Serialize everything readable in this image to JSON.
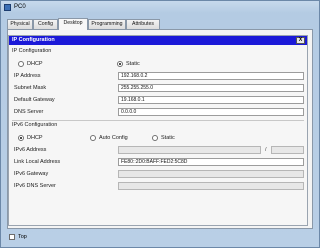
{
  "window": {
    "title": "PC0"
  },
  "tabs": [
    {
      "label": "Physical"
    },
    {
      "label": "Config"
    },
    {
      "label": "Desktop"
    },
    {
      "label": "Programming"
    },
    {
      "label": "Attributes"
    }
  ],
  "panel": {
    "title": "IP Configuration",
    "close_label": "X"
  },
  "ipv4": {
    "section_title": "IP Configuration",
    "dhcp_label": "DHCP",
    "static_label": "Static",
    "mode": "Static",
    "ip_address": {
      "label": "IP Address",
      "value": "192.168.0.2"
    },
    "subnet_mask": {
      "label": "Subnet Mask",
      "value": "255.255.255.0"
    },
    "default_gateway": {
      "label": "Default Gateway",
      "value": "19.168.0.1"
    },
    "dns_server": {
      "label": "DNS Server",
      "value": "0.0.0.0"
    }
  },
  "ipv6": {
    "section_title": "IPv6 Configuration",
    "dhcp_label": "DHCP",
    "autoconfig_label": "Auto Config",
    "static_label": "Static",
    "mode": "DHCP",
    "address": {
      "label": "IPv6 Address",
      "value": "",
      "prefix": "",
      "separator": "/"
    },
    "link_local": {
      "label": "Link Local Address",
      "value": "FE80::2D0:BAFF:FED2:5C8D"
    },
    "gateway": {
      "label": "IPv6 Gateway",
      "value": ""
    },
    "dns_server": {
      "label": "IPv6 DNS Server",
      "value": ""
    }
  },
  "footer": {
    "top_label": "Top",
    "top_checked": false
  }
}
